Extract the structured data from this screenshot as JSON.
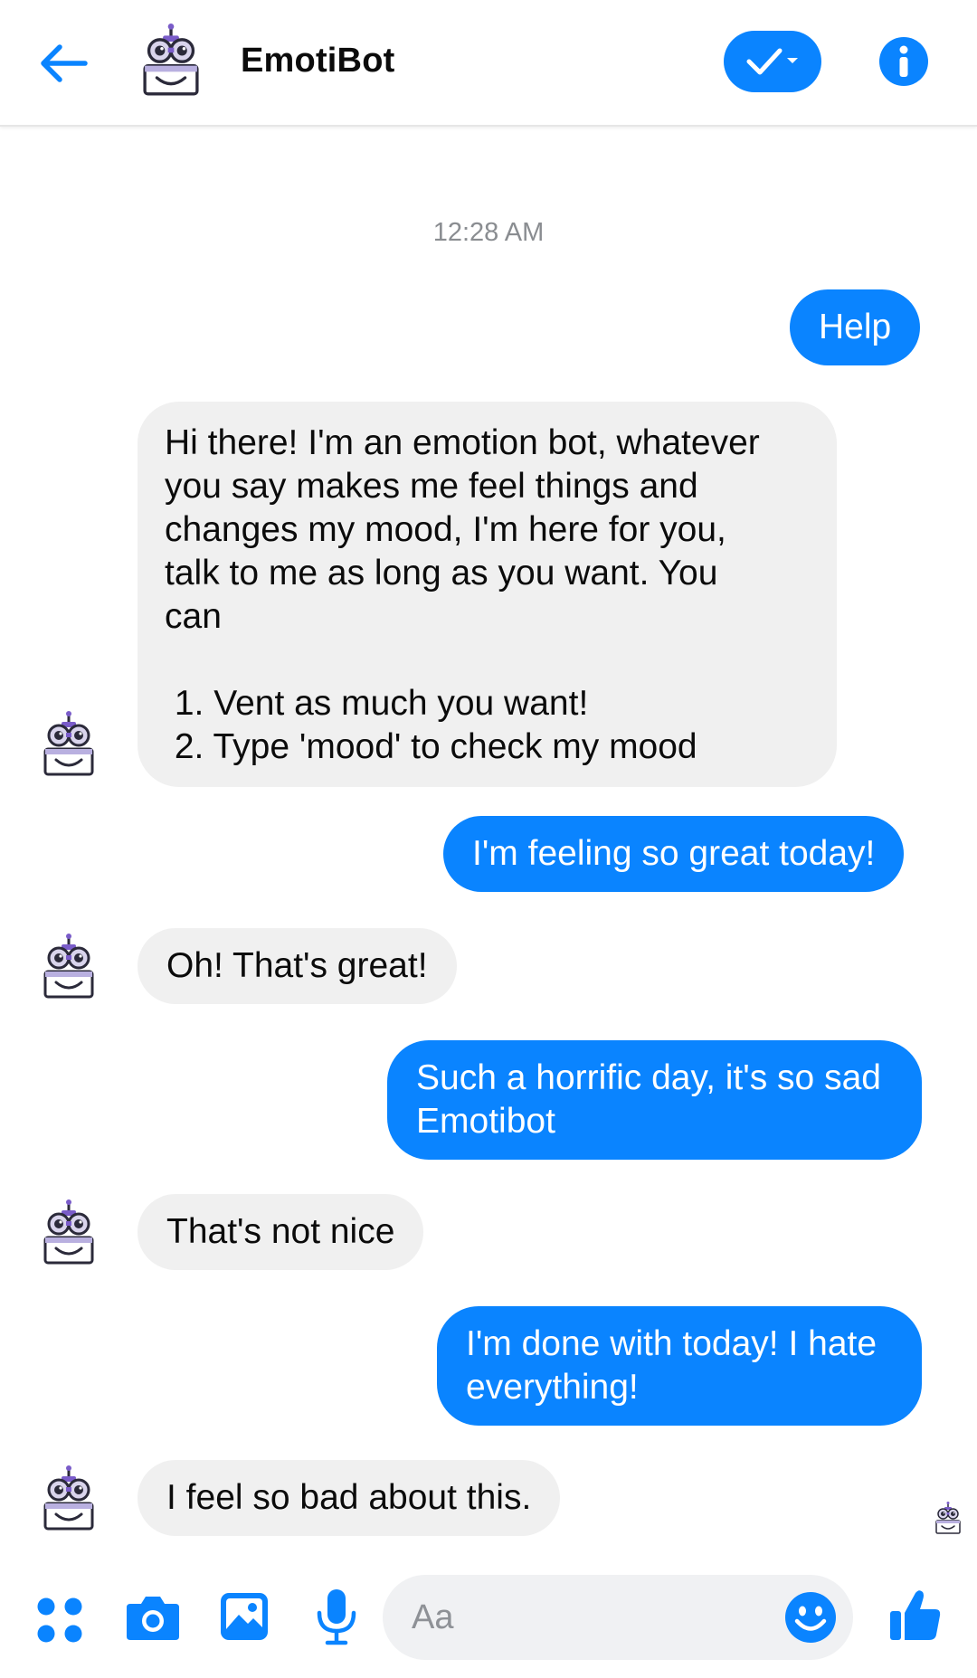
{
  "header": {
    "title": "EmotiBot",
    "back_icon": "arrow-left-icon",
    "status_icon": "check-dropdown-icon",
    "info_icon": "info-icon"
  },
  "colors": {
    "accent": "#0a84ff",
    "incoming_bubble": "#f0f0f0",
    "timestamp": "#8a8d91"
  },
  "chat": {
    "timestamp": "12:28 AM",
    "messages": [
      {
        "from": "user",
        "text": "Help"
      },
      {
        "from": "bot",
        "text": "Hi there! I'm an emotion bot, whatever\nyou say makes me feel things and\nchanges my mood, I'm here for you,\ntalk to me as long as you want. You\ncan\n\n 1. Vent as much you want!\n 2. Type 'mood' to check my mood"
      },
      {
        "from": "user",
        "text": "I'm feeling so great today!"
      },
      {
        "from": "bot",
        "text": "Oh! That's great!"
      },
      {
        "from": "user",
        "text": "Such a horrific day, it's so sad\nEmotibot"
      },
      {
        "from": "bot",
        "text": "That's not nice"
      },
      {
        "from": "user",
        "text": "I'm done with today! I hate\neverything!"
      },
      {
        "from": "bot",
        "text": "I feel so bad about this."
      }
    ]
  },
  "composer": {
    "placeholder": "Aa",
    "value": "",
    "icons": [
      "apps-icon",
      "camera-icon",
      "image-icon",
      "microphone-icon",
      "emoji-icon",
      "thumbs-up-icon"
    ]
  }
}
